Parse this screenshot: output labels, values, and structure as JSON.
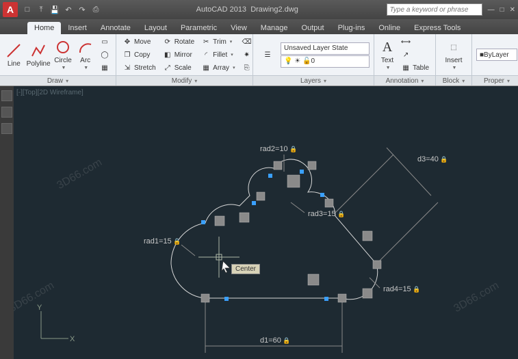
{
  "title": {
    "app": "AutoCAD 2013",
    "doc": "Drawing2.dwg"
  },
  "search": {
    "placeholder": "Type a keyword or phrase"
  },
  "tabs": [
    "Home",
    "Insert",
    "Annotate",
    "Layout",
    "Parametric",
    "View",
    "Manage",
    "Output",
    "Plug-ins",
    "Online",
    "Express Tools"
  ],
  "draw": {
    "line": "Line",
    "polyline": "Polyline",
    "circle": "Circle",
    "arc": "Arc",
    "label": "Draw"
  },
  "modify": {
    "move": "Move",
    "copy": "Copy",
    "stretch": "Stretch",
    "rotate": "Rotate",
    "mirror": "Mirror",
    "scale": "Scale",
    "trim": "Trim",
    "fillet": "Fillet",
    "array": "Array",
    "label": "Modify"
  },
  "layers": {
    "state": "Unsaved Layer State",
    "current": "0",
    "label": "Layers"
  },
  "annotation": {
    "text": "Text",
    "table": "Table",
    "label": "Annotation"
  },
  "block": {
    "insert": "Insert",
    "label": "Block"
  },
  "props": {
    "bylayer": "ByLayer",
    "label": "Proper"
  },
  "dims": {
    "rad1": "rad1=15",
    "rad2": "rad2=10",
    "rad3": "rad3=15",
    "rad4": "rad4=15",
    "d1": "d1=60",
    "d3": "d3=40"
  },
  "tooltip": "Center",
  "ucs": {
    "x": "X",
    "y": "Y"
  },
  "watermark": "3D66.com"
}
